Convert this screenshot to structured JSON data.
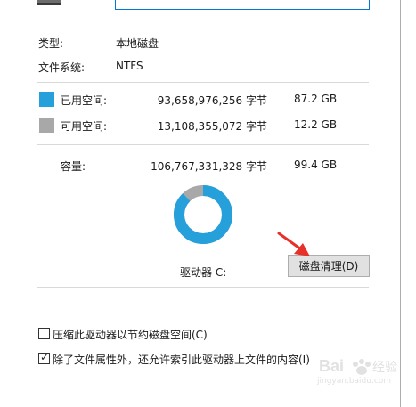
{
  "properties": {
    "type_label": "类型:",
    "type_value": "本地磁盘",
    "fs_label": "文件系统:",
    "fs_value": "NTFS"
  },
  "usage": {
    "used_label": "已用空间:",
    "used_bytes": "93,658,976,256 字节",
    "used_gb": "87.2 GB",
    "used_color": "#26a0da",
    "free_label": "可用空间:",
    "free_bytes": "13,108,355,072 字节",
    "free_gb": "12.2 GB",
    "free_color": "#a8a8a8",
    "capacity_label": "容量:",
    "capacity_bytes": "106,767,331,328 字节",
    "capacity_gb": "99.4 GB",
    "used_fraction": 0.877
  },
  "drive": {
    "label": "驱动器 C:",
    "cleanup_button": "磁盘清理(D)"
  },
  "options": {
    "compress_label": "压缩此驱动器以节约磁盘空间(C)",
    "compress_checked": false,
    "index_label": "除了文件属性外，还允许索引此驱动器上文件的内容(I)",
    "index_checked": true
  },
  "watermark": {
    "brand": "Bai",
    "brand_suffix": "经验",
    "url": "jingyan.baidu.com"
  }
}
